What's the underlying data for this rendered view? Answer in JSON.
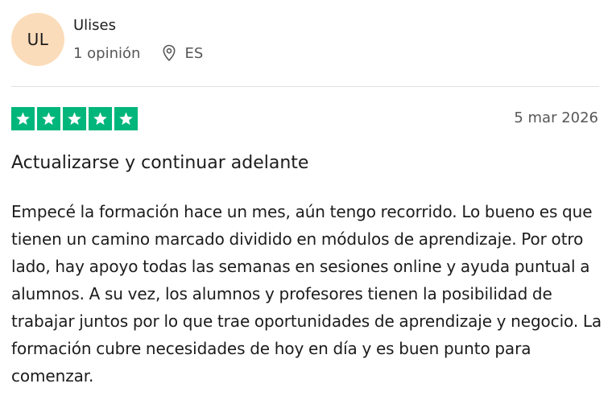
{
  "reviewer": {
    "initials": "UL",
    "name": "Ulises",
    "review_count": "1 opinión",
    "location_icon": "location-pin-icon",
    "country": "ES",
    "avatar_color": "#fbdcba"
  },
  "review": {
    "rating": 5,
    "rating_max": 5,
    "star_color": "#00b67a",
    "star_icon": "star-icon",
    "date": "5 mar 2026",
    "title": "Actualizarse y continuar adelante",
    "body": "Empecé la formación hace un mes, aún tengo recorrido. Lo bueno es que tienen un camino marcado dividido en módulos de aprendizaje. Por otro lado, hay apoyo todas las semanas en sesiones online y ayuda puntual a alumnos. A su vez, los alumnos y profesores tienen la posibilidad de trabajar juntos por lo que trae oportunidades de aprendizaje y negocio. La formación cubre necesidades de hoy en día y es buen punto para comenzar."
  }
}
